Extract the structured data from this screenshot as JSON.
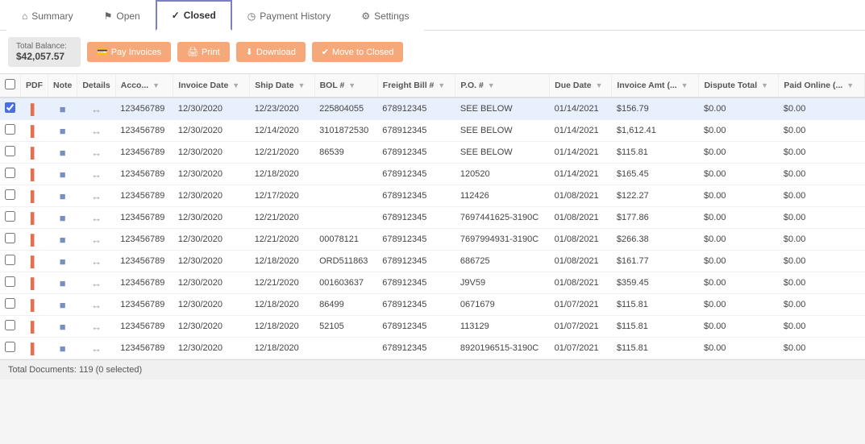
{
  "tabs": [
    {
      "id": "summary",
      "label": "Summary",
      "icon": "home",
      "active": false
    },
    {
      "id": "open",
      "label": "Open",
      "icon": "flag",
      "active": false
    },
    {
      "id": "closed",
      "label": "Closed",
      "icon": "check",
      "active": true
    },
    {
      "id": "payment-history",
      "label": "Payment History",
      "icon": "clock",
      "active": false
    },
    {
      "id": "settings",
      "label": "Settings",
      "icon": "gear",
      "active": false
    }
  ],
  "toolbar": {
    "balance_label": "Total Balance:",
    "balance_amount": "$42,057.57",
    "buttons": [
      {
        "id": "pay-invoices",
        "label": "Pay Invoices",
        "icon": "💳"
      },
      {
        "id": "print",
        "label": "Print",
        "icon": "🖨"
      },
      {
        "id": "download",
        "label": "Download",
        "icon": "⬇"
      },
      {
        "id": "move-to-closed",
        "label": "Move to Closed",
        "icon": "✔"
      }
    ]
  },
  "table": {
    "columns": [
      {
        "id": "pdf",
        "label": "PDF"
      },
      {
        "id": "note",
        "label": "Note"
      },
      {
        "id": "details",
        "label": "Details"
      },
      {
        "id": "account",
        "label": "Acco..."
      },
      {
        "id": "invoice-date",
        "label": "Invoice Date"
      },
      {
        "id": "ship-date",
        "label": "Ship Date"
      },
      {
        "id": "bol",
        "label": "BOL #"
      },
      {
        "id": "freight-bill",
        "label": "Freight Bill #"
      },
      {
        "id": "po",
        "label": "P.O. #"
      },
      {
        "id": "due-date",
        "label": "Due Date"
      },
      {
        "id": "invoice-amt",
        "label": "Invoice Amt (..."
      },
      {
        "id": "dispute-total",
        "label": "Dispute Total"
      },
      {
        "id": "paid-online",
        "label": "Paid Online (..."
      }
    ],
    "rows": [
      {
        "selected": true,
        "account": "123456789",
        "invoice_date": "12/30/2020",
        "ship_date": "12/23/2020",
        "bol": "225804055",
        "freight_bill": "678912345",
        "po": "SEE BELOW",
        "due_date": "01/14/2021",
        "invoice_amt": "$156.79",
        "dispute_total": "$0.00",
        "paid_online": "$0.00"
      },
      {
        "selected": false,
        "account": "123456789",
        "invoice_date": "12/30/2020",
        "ship_date": "12/14/2020",
        "bol": "3101872530",
        "freight_bill": "678912345",
        "po": "SEE BELOW",
        "due_date": "01/14/2021",
        "invoice_amt": "$1,612.41",
        "dispute_total": "$0.00",
        "paid_online": "$0.00"
      },
      {
        "selected": false,
        "account": "123456789",
        "invoice_date": "12/30/2020",
        "ship_date": "12/21/2020",
        "bol": "86539",
        "freight_bill": "678912345",
        "po": "SEE BELOW",
        "due_date": "01/14/2021",
        "invoice_amt": "$115.81",
        "dispute_total": "$0.00",
        "paid_online": "$0.00"
      },
      {
        "selected": false,
        "account": "123456789",
        "invoice_date": "12/30/2020",
        "ship_date": "12/18/2020",
        "bol": "",
        "freight_bill": "678912345",
        "po": "120520",
        "due_date": "01/14/2021",
        "invoice_amt": "$165.45",
        "dispute_total": "$0.00",
        "paid_online": "$0.00"
      },
      {
        "selected": false,
        "account": "123456789",
        "invoice_date": "12/30/2020",
        "ship_date": "12/17/2020",
        "bol": "",
        "freight_bill": "678912345",
        "po": "112426",
        "due_date": "01/08/2021",
        "invoice_amt": "$122.27",
        "dispute_total": "$0.00",
        "paid_online": "$0.00"
      },
      {
        "selected": false,
        "account": "123456789",
        "invoice_date": "12/30/2020",
        "ship_date": "12/21/2020",
        "bol": "",
        "freight_bill": "678912345",
        "po": "7697441625-3190C",
        "due_date": "01/08/2021",
        "invoice_amt": "$177.86",
        "dispute_total": "$0.00",
        "paid_online": "$0.00"
      },
      {
        "selected": false,
        "account": "123456789",
        "invoice_date": "12/30/2020",
        "ship_date": "12/21/2020",
        "bol": "00078121",
        "freight_bill": "678912345",
        "po": "7697994931-3190C",
        "due_date": "01/08/2021",
        "invoice_amt": "$266.38",
        "dispute_total": "$0.00",
        "paid_online": "$0.00"
      },
      {
        "selected": false,
        "account": "123456789",
        "invoice_date": "12/30/2020",
        "ship_date": "12/18/2020",
        "bol": "ORD511863",
        "freight_bill": "678912345",
        "po": "686725",
        "due_date": "01/08/2021",
        "invoice_amt": "$161.77",
        "dispute_total": "$0.00",
        "paid_online": "$0.00"
      },
      {
        "selected": false,
        "account": "123456789",
        "invoice_date": "12/30/2020",
        "ship_date": "12/21/2020",
        "bol": "001603637",
        "freight_bill": "678912345",
        "po": "J9V59",
        "due_date": "01/08/2021",
        "invoice_amt": "$359.45",
        "dispute_total": "$0.00",
        "paid_online": "$0.00"
      },
      {
        "selected": false,
        "account": "123456789",
        "invoice_date": "12/30/2020",
        "ship_date": "12/18/2020",
        "bol": "86499",
        "freight_bill": "678912345",
        "po": "0671679",
        "due_date": "01/07/2021",
        "invoice_amt": "$115.81",
        "dispute_total": "$0.00",
        "paid_online": "$0.00"
      },
      {
        "selected": false,
        "account": "123456789",
        "invoice_date": "12/30/2020",
        "ship_date": "12/18/2020",
        "bol": "52105",
        "freight_bill": "678912345",
        "po": "113129",
        "due_date": "01/07/2021",
        "invoice_amt": "$115.81",
        "dispute_total": "$0.00",
        "paid_online": "$0.00"
      },
      {
        "selected": false,
        "account": "123456789",
        "invoice_date": "12/30/2020",
        "ship_date": "12/18/2020",
        "bol": "",
        "freight_bill": "678912345",
        "po": "8920196515-3190C",
        "due_date": "01/07/2021",
        "invoice_amt": "$115.81",
        "dispute_total": "$0.00",
        "paid_online": "$0.00"
      }
    ],
    "footer": "Total Documents: 119 (0 selected)"
  }
}
